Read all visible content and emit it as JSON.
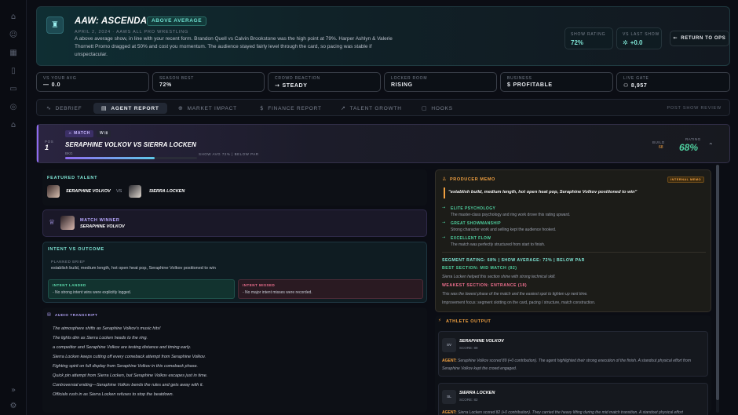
{
  "sidebar": {
    "icons": [
      "home-icon",
      "users-icon",
      "calendar-icon",
      "book-icon",
      "briefcase-icon",
      "globe-icon",
      "graduation-icon",
      "collapse-icon",
      "settings-icon"
    ]
  },
  "header": {
    "title": "AAW: ASCENDANCY",
    "badge": "ABOVE AVERAGE",
    "meta": "APRIL 2, 2024 · AAWS ALL PRO WRESTLING",
    "description": "A above average show, in line with your recent form. Brandon Quell vs Calvin Brookstone was the high point at 79%. Harper Ashlyn & Valerie Thornett Promo dragged at 50% and cost you momentum. The audience stayed fairly level through the card, so pacing was stable if unspectacular.",
    "show_rating_label": "SHOW RATING",
    "show_rating_value": "72%",
    "vs_last_label": "VS LAST SHOW",
    "vs_last_value": "+0.0",
    "return_label": "RETURN TO OPS"
  },
  "kpis": [
    {
      "label": "VS YOUR AVG",
      "value": "0.0",
      "icon": "—"
    },
    {
      "label": "SEASON BEST",
      "value": "72%",
      "icon": ""
    },
    {
      "label": "CROWD REACTION",
      "value": "STEADY",
      "icon": "→"
    },
    {
      "label": "LOCKER ROOM",
      "value": "RISING",
      "icon": ""
    },
    {
      "label": "BUSINESS",
      "value": "PROFITABLE",
      "icon": "$"
    },
    {
      "label": "LIVE GATE",
      "value": "8,957",
      "icon": "👥"
    }
  ],
  "tabs": [
    {
      "label": "DEBRIEF",
      "icon": "∿"
    },
    {
      "label": "AGENT REPORT",
      "icon": "▤"
    },
    {
      "label": "MARKET IMPACT",
      "icon": "⊕"
    },
    {
      "label": "FINANCE REPORT",
      "icon": "$"
    },
    {
      "label": "TALENT GROWTH",
      "icon": "↗"
    },
    {
      "label": "HOOKS",
      "icon": "▢"
    }
  ],
  "tab_right": "POST SHOW REVIEW",
  "match": {
    "tag": "MATCH",
    "tag2": "W  ⅠⅡ",
    "pos_label": "POS",
    "pos_value": "1",
    "title": "SERAPHINE VOLKOV VS SIERRA LOCKEN",
    "bar_label": "BKG",
    "avg_text": "SHOW AVG 72% | BELOW PAR",
    "bar_fill": 0.68,
    "build_label": "BUILD",
    "build_value": "68",
    "rating_label": "RATING",
    "rating_value": "68%"
  },
  "featured": {
    "label": "FEATURED TALENT",
    "p1": "SERAPHINE VOLKOV",
    "vs": "VS",
    "p2": "SIERRA LOCKEN"
  },
  "winner": {
    "label": "MATCH WINNER",
    "name": "SERAPHINE VOLKOV"
  },
  "intent": {
    "label": "INTENT VS OUTCOME",
    "brief_label": "PLANNED BRIEF",
    "brief": "establish build, medium length, hot open heat pop, Seraphine Volkov positioned to win",
    "landed_label": "INTENT LANDED",
    "landed": "- No strong intent wins were explicitly logged.",
    "missed_label": "INTENT MISSED",
    "missed": "- No major intent misses were recorded."
  },
  "transcript": {
    "label": "AUDIO TRANSCRIPT",
    "lines": [
      "The atmosphere shifts as Seraphine Volkov's music hits!",
      "The lights dim as Sierra Locken heads to the ring.",
      "a competitor and Seraphine Volkov are testing distance and timing early.",
      "Sierra Locken keeps cutting off every comeback attempt from Seraphine Volkov.",
      "Fighting spirit on full display from Seraphine Volkov in this comeback phase.",
      "Quick pin attempt from Sierra Locken, but Seraphine Volkov escapes just in time.",
      "Controversial ending—Seraphine Volkov bends the rules and gets away with it.",
      "Officials rush in as Sierra Locken refuses to stop the beatdown."
    ]
  },
  "memo": {
    "label": "PRODUCER MEMO",
    "badge": "INTERNAL MEMO",
    "quote": "\"establish build, medium length, hot open heat pop, Seraphine Volkov positioned to win\"",
    "items": [
      {
        "title": "ELITE PSYCHOLOGY",
        "text": "The master-class psychology and ring work drove this rating upward."
      },
      {
        "title": "GREAT SHOWMANSHIP",
        "text": "Strong character work and selling kept the audience hooked."
      },
      {
        "title": "EXCELLENT FLOW",
        "text": "The match was perfectly structured from start to finish."
      }
    ],
    "segment_rating": "SEGMENT RATING: 68% | SHOW AVERAGE: 72% | BELOW PAR",
    "best_section": "BEST SECTION: MID MATCH (92)",
    "best_text": "Sierra Locken helped this section shine with strong technical skill.",
    "weakest_section": "WEAKEST SECTION: ENTRANCE (18)",
    "weakest_text": "This was the lowest phase of the match and the easiest spot to tighten up next time.",
    "improvement": "Improvement focus: segment slotting on the card, pacing / structure, match construction."
  },
  "athletes": {
    "label": "ATHLETE OUTPUT",
    "list": [
      {
        "initials": "SV",
        "name": "SERAPHINE VOLKOV",
        "score": "SCORE: 89",
        "agent_label": "AGENT:",
        "note": "Seraphine Volkov scored 89 (+0 contribution). The agent highlighted their strong execution of the finish. A standout physical effort from Seraphine Volkov kept the crowd engaged."
      },
      {
        "initials": "SL",
        "name": "SIERRA LOCKEN",
        "score": "SCORE: 82",
        "agent_label": "AGENT:",
        "note": "Sierra Locken scored 82 (+0 contribution). They carried the heavy lifting during the mid match transition. A standout physical effort"
      }
    ]
  },
  "colors": {
    "accent_teal": "#7fe6d6",
    "accent_purple": "#8f6cf0",
    "accent_orange": "#f0a040",
    "rating_green": "#4fd1a0"
  }
}
